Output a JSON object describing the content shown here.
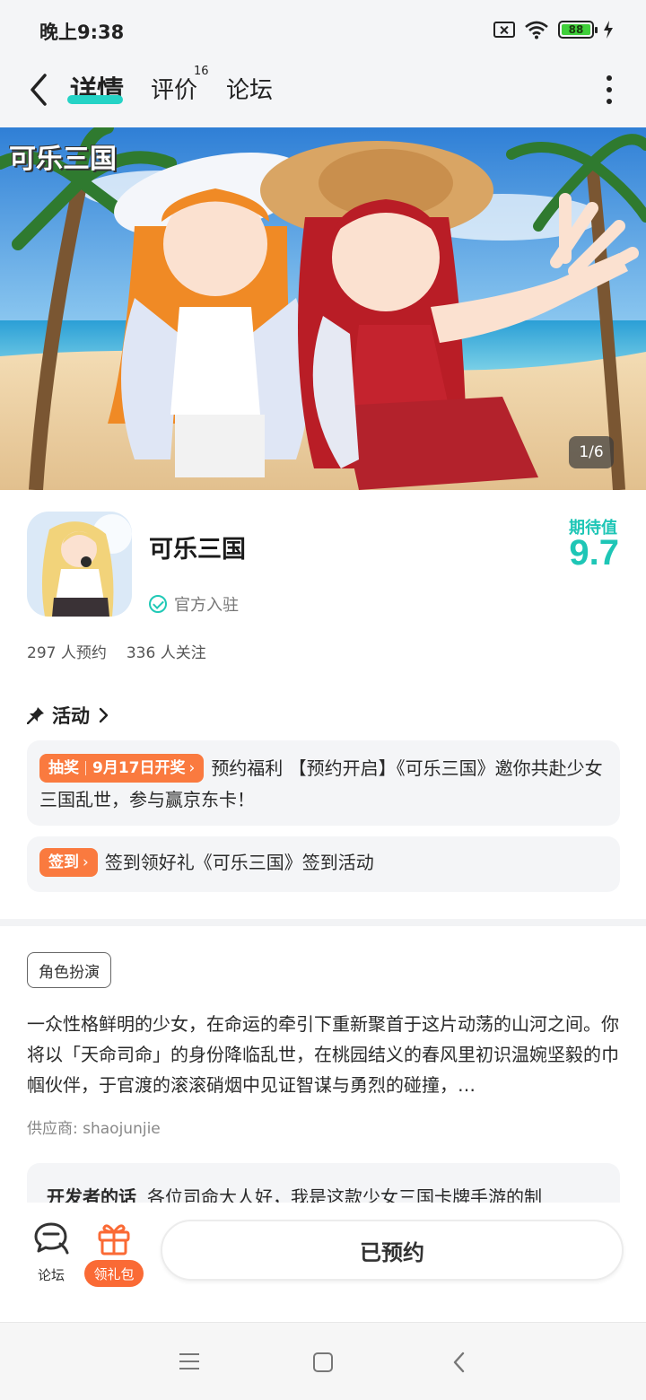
{
  "status_bar": {
    "time": "晚上9:38",
    "battery": "88"
  },
  "nav": {
    "tabs": [
      {
        "label": "详情",
        "active": true
      },
      {
        "label": "评价",
        "badge": "16"
      },
      {
        "label": "论坛"
      }
    ]
  },
  "banner": {
    "logo_text": "可乐三国",
    "page_indicator": "1/6"
  },
  "game": {
    "name": "可乐三国",
    "official": "官方入驻",
    "expect_label": "期待值",
    "expect_value": "9.7",
    "reservations": "297 人预约",
    "followers": "336 人关注"
  },
  "activities": {
    "title": "活动",
    "items": [
      {
        "tag_type": "抽奖",
        "tag_date": "9月17日开奖",
        "text": "预约福利 【预约开启】《可乐三国》邀你共赴少女三国乱世，参与赢京东卡！"
      },
      {
        "tag_type": "签到",
        "text": "签到领好礼《可乐三国》签到活动"
      }
    ]
  },
  "info": {
    "genre": "角色扮演",
    "description": "一众性格鲜明的少女，在命运的牵引下重新聚首于这片动荡的山河之间。你将以「天命司命」的身份降临乱世，在桃园结义的春风里初识温婉坚毅的巾帼伙伴，于官渡的滚滚硝烟中见证智谋与勇烈的碰撞，…",
    "supplier": "供应商: shaojunjie",
    "developer_label": "开发者的话",
    "developer_text": "各位司命大人好，我是这款少女三国卡牌手游的制"
  },
  "action_bar": {
    "forum_label": "论坛",
    "gift_label": "领礼包",
    "reserve_label": "已预约"
  },
  "colors": {
    "accent_teal": "#1ec6b6",
    "tag_orange": "#fa7a3f",
    "underline": "#25d3c6"
  }
}
